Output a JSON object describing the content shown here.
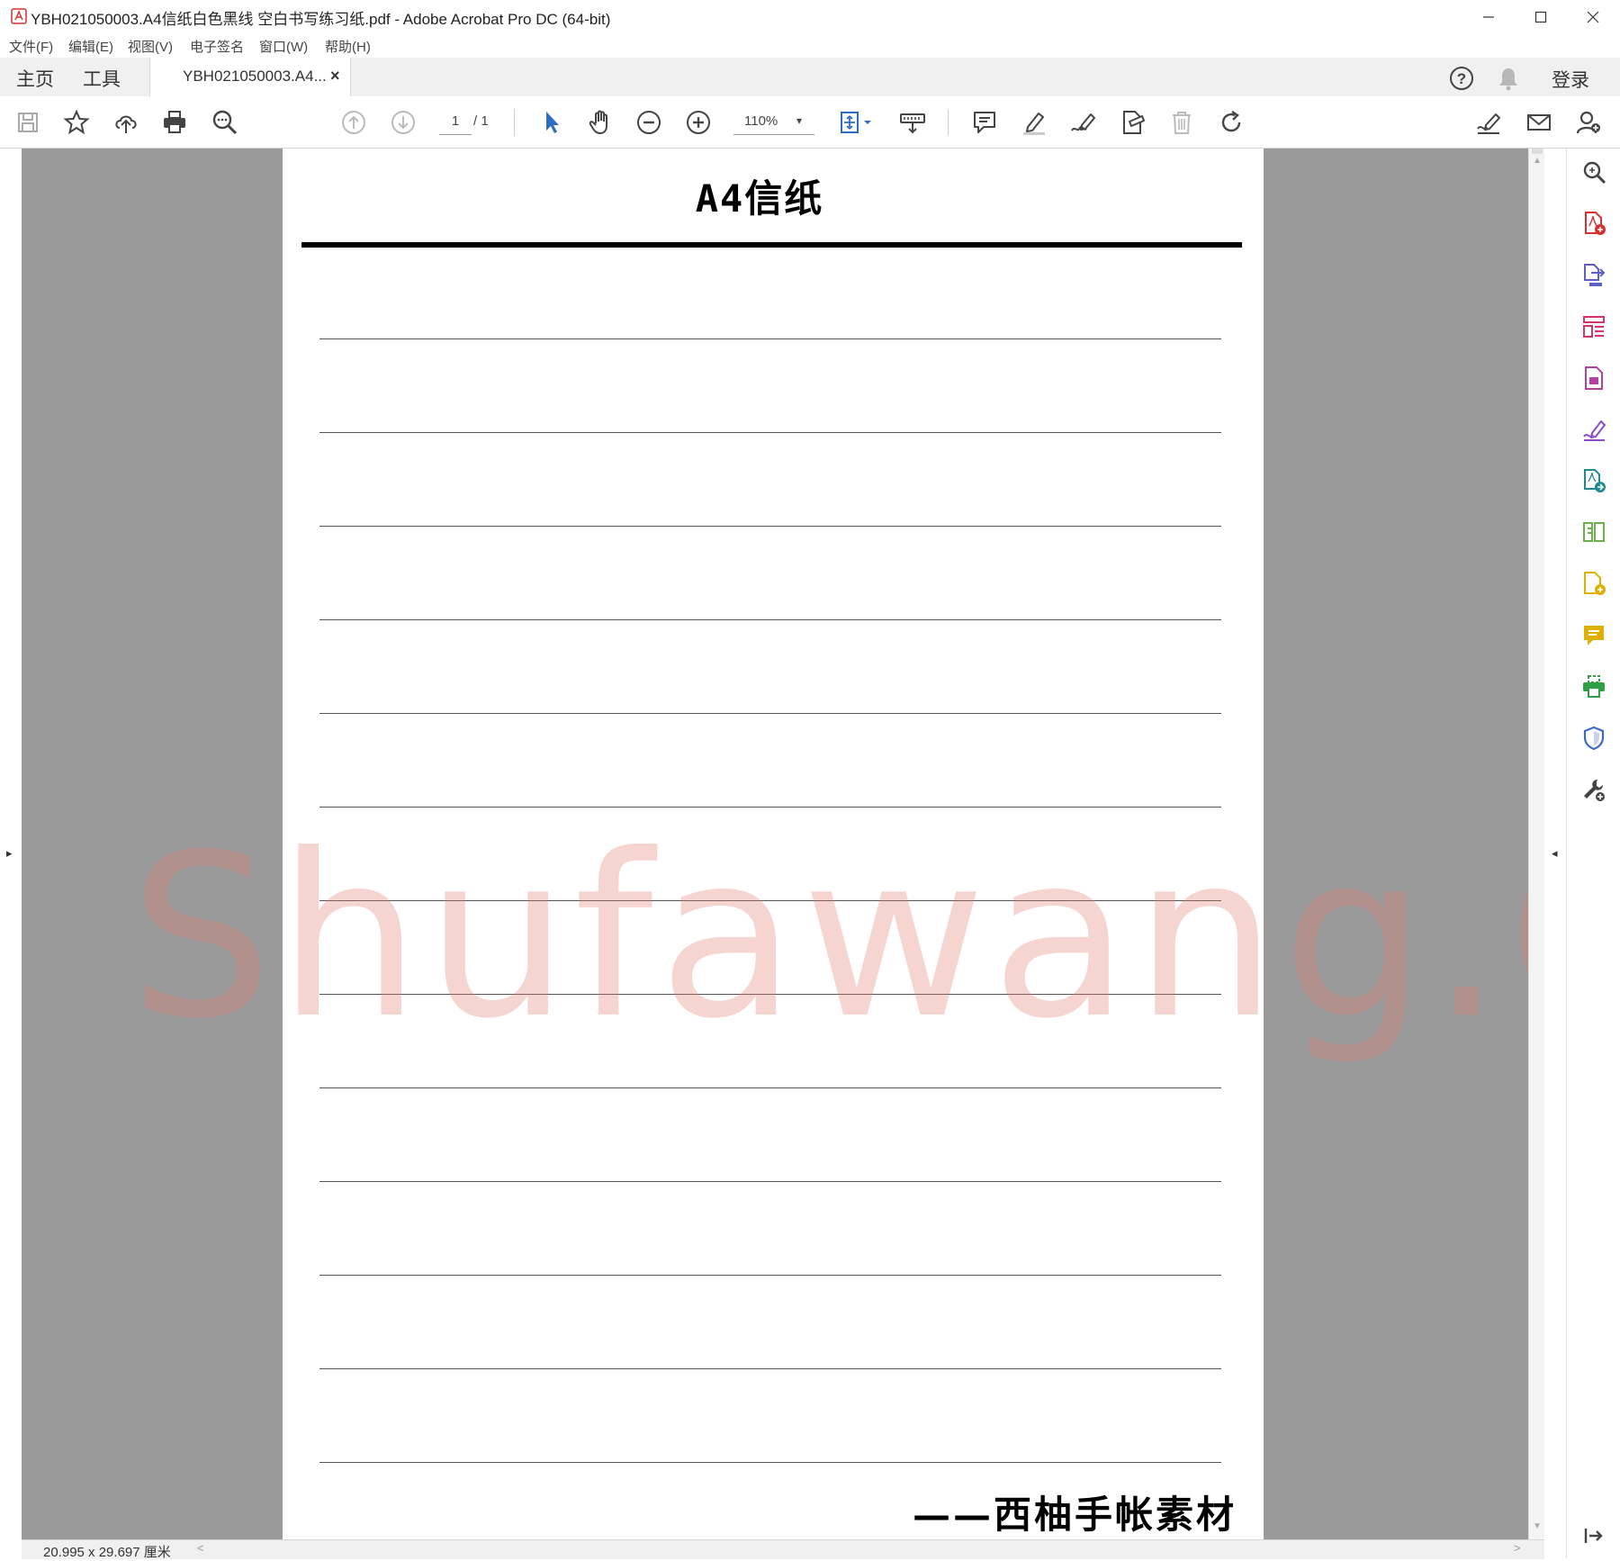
{
  "window": {
    "title": "YBH021050003.A4信纸白色黑线 空白书写练习纸.pdf - Adobe Acrobat Pro DC (64-bit)",
    "minimize_glyph": "—",
    "maximize_glyph": "☐",
    "close_glyph": "✕"
  },
  "menu": {
    "items": [
      "文件(F)",
      "编辑(E)",
      "视图(V)",
      "电子签名",
      "窗口(W)",
      "帮助(H)"
    ]
  },
  "tabs": {
    "home": "主页",
    "tools": "工具",
    "document": "YBH021050003.A4...",
    "close_glyph": "×",
    "login": "登录"
  },
  "toolbar": {
    "page_current": "1",
    "page_total": "/ 1",
    "zoom": "110%",
    "zoom_caret": "▾"
  },
  "document": {
    "title": "A4信纸",
    "signature": "——西柚手帐素材",
    "ruled_line_count": 13,
    "watermark": "Shufawang.CN"
  },
  "statusbar": {
    "dimensions": "20.995 x 29.697 厘米",
    "scroll_left": "<",
    "scroll_right": ">"
  },
  "scroll": {
    "up": "▲",
    "down": "▼"
  },
  "panels": {
    "left_expand": "▸",
    "right_expand": "◂"
  },
  "colors": {
    "accent_blue": "#2b6cc4",
    "acrobat_red": "#d8302f",
    "watermark": "#e2786e",
    "canvas_gray": "#9a9a9a"
  },
  "right_pane_icons": [
    "search-zoom-icon",
    "create-pdf-icon",
    "export-pdf-icon",
    "organize-pages-icon",
    "edit-pdf-icon",
    "fill-sign-icon",
    "combine-files-icon",
    "compare-icon",
    "export-stamp-icon",
    "comment-icon",
    "print-production-icon",
    "protect-icon",
    "more-tools-icon",
    "collapse-pane-icon"
  ]
}
